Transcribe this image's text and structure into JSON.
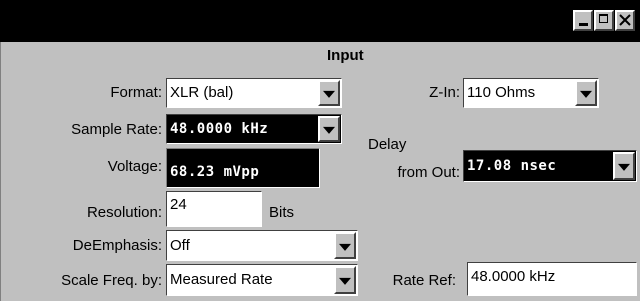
{
  "window": {
    "title": "",
    "controls": {
      "minimize": "_",
      "maximize": "□",
      "close": "×"
    }
  },
  "panel": {
    "heading": "Input"
  },
  "format": {
    "label": "Format:",
    "value": "XLR (bal)"
  },
  "z_in": {
    "label": "Z-In:",
    "value": "110 Ohms"
  },
  "sample_rate": {
    "label": "Sample Rate:",
    "value": "48.0000 kHz"
  },
  "voltage": {
    "label": "Voltage:",
    "value": "68.23  mVpp"
  },
  "delay": {
    "label_line1": "Delay",
    "label_line2": "from Out:",
    "value": "17.08  nsec"
  },
  "resolution": {
    "label": "Resolution:",
    "value": "24",
    "unit": "Bits"
  },
  "deemphasis": {
    "label": "DeEmphasis:",
    "value": "Off"
  },
  "scale_freq": {
    "label": "Scale Freq. by:",
    "value": "Measured Rate"
  },
  "rate_ref": {
    "label": "Rate Ref:",
    "value": "48.0000 kHz"
  }
}
